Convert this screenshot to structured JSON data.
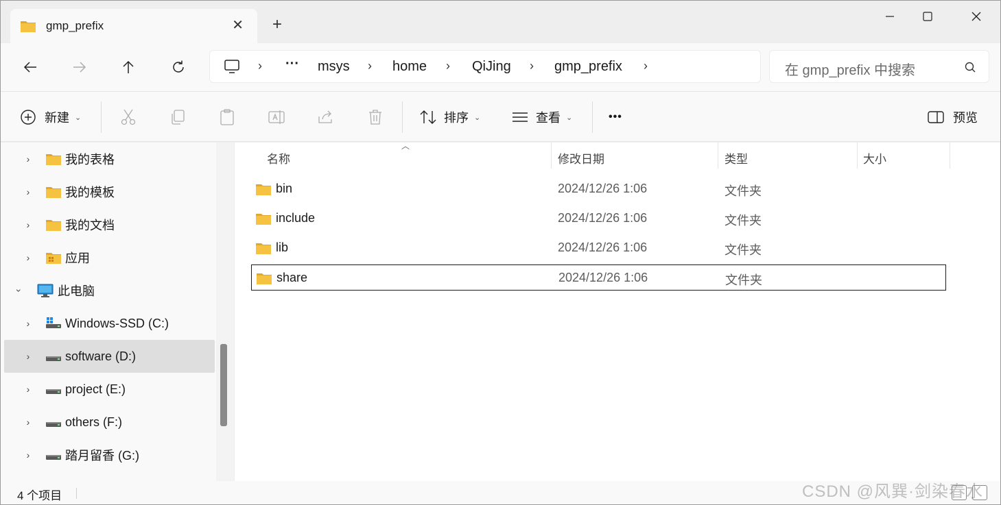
{
  "tab": {
    "title": "gmp_prefix",
    "close": "✕",
    "new_tab": "+"
  },
  "window_controls": {
    "minimize": "minimize",
    "maximize": "maximize",
    "close": "close"
  },
  "address": {
    "overflow": "···",
    "crumbs": [
      "msys",
      "home",
      "QiJing",
      "gmp_prefix"
    ],
    "separator": "›"
  },
  "search": {
    "placeholder": "在 gmp_prefix 中搜索"
  },
  "toolbar": {
    "new_label": "新建",
    "sort_label": "排序",
    "view_label": "查看",
    "more": "•••",
    "preview_label": "预览"
  },
  "nav": {
    "items": [
      {
        "label": "我的表格",
        "icon": "folder-icon",
        "expanded": false
      },
      {
        "label": "我的模板",
        "icon": "folder-icon",
        "expanded": false
      },
      {
        "label": "我的文档",
        "icon": "folder-icon",
        "expanded": false
      },
      {
        "label": "应用",
        "icon": "apps-folder-icon",
        "expanded": false
      },
      {
        "label": "此电脑",
        "icon": "computer-icon",
        "expanded": true
      },
      {
        "label": "Windows-SSD (C:)",
        "icon": "windows-drive-icon",
        "expanded": false
      },
      {
        "label": "software (D:)",
        "icon": "drive-icon",
        "expanded": false,
        "selected": true
      },
      {
        "label": "project (E:)",
        "icon": "drive-icon",
        "expanded": false
      },
      {
        "label": "others (F:)",
        "icon": "drive-icon",
        "expanded": false
      },
      {
        "label": "踏月留香 (G:)",
        "icon": "drive-icon",
        "expanded": false
      }
    ]
  },
  "columns": {
    "name": "名称",
    "date": "修改日期",
    "type": "类型",
    "size": "大小"
  },
  "files": [
    {
      "name": "bin",
      "date": "2024/12/26 1:06",
      "type": "文件夹"
    },
    {
      "name": "include",
      "date": "2024/12/26 1:06",
      "type": "文件夹"
    },
    {
      "name": "lib",
      "date": "2024/12/26 1:06",
      "type": "文件夹"
    },
    {
      "name": "share",
      "date": "2024/12/26 1:06",
      "type": "文件夹"
    }
  ],
  "status": {
    "count": "4 个项目"
  },
  "watermark": "CSDN @风巽·剑染春水",
  "colors": {
    "folder": "#f5c242",
    "folder_dark": "#e0a82e",
    "selection": "#dedede",
    "accent": "#0067c0"
  }
}
